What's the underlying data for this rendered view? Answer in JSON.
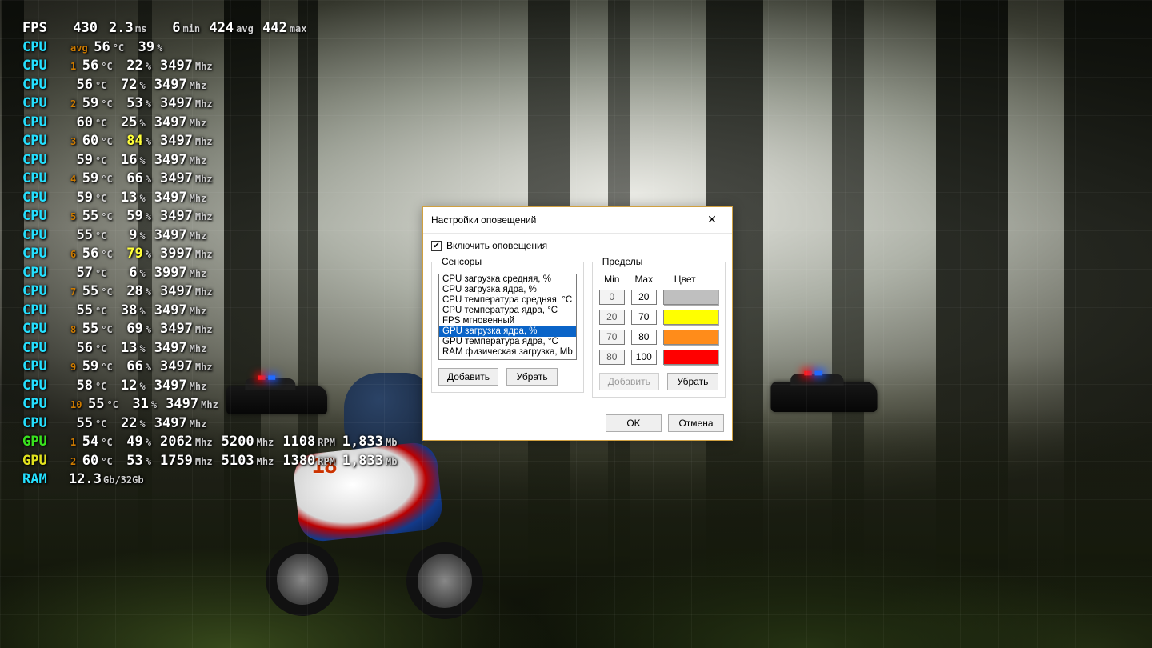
{
  "fps": {
    "label": "FPS",
    "value": "430",
    "ms": "2.3",
    "ms_unit": "ms",
    "min": "6",
    "min_unit": "min",
    "avg": "424",
    "avg_unit": "avg",
    "max": "442",
    "max_unit": "max"
  },
  "cpu_avg": {
    "label": "CPU",
    "idx": "avg",
    "temp": "56",
    "pct": "39"
  },
  "units": {
    "deg": "°C",
    "pct": "%",
    "mhz": "Mhz",
    "rpm": "RPM",
    "mb": "Mb",
    "gb": "Gb/32Gb"
  },
  "cpus": [
    {
      "label": "CPU",
      "idx": "1",
      "temp": "56",
      "pct": "22",
      "pct_hi": false,
      "mhz": "3497"
    },
    {
      "label": "CPU",
      "idx": "",
      "temp": "56",
      "pct": "72",
      "pct_hi": false,
      "mhz": "3497"
    },
    {
      "label": "CPU",
      "idx": "2",
      "temp": "59",
      "pct": "53",
      "pct_hi": false,
      "mhz": "3497"
    },
    {
      "label": "CPU",
      "idx": "",
      "temp": "60",
      "pct": "25",
      "pct_hi": false,
      "mhz": "3497"
    },
    {
      "label": "CPU",
      "idx": "3",
      "temp": "60",
      "pct": "84",
      "pct_hi": true,
      "mhz": "3497"
    },
    {
      "label": "CPU",
      "idx": "",
      "temp": "59",
      "pct": "16",
      "pct_hi": false,
      "mhz": "3497"
    },
    {
      "label": "CPU",
      "idx": "4",
      "temp": "59",
      "pct": "66",
      "pct_hi": false,
      "mhz": "3497"
    },
    {
      "label": "CPU",
      "idx": "",
      "temp": "59",
      "pct": "13",
      "pct_hi": false,
      "mhz": "3497"
    },
    {
      "label": "CPU",
      "idx": "5",
      "temp": "55",
      "pct": "59",
      "pct_hi": false,
      "mhz": "3497"
    },
    {
      "label": "CPU",
      "idx": "",
      "temp": "55",
      "pct": "9",
      "pct_hi": false,
      "mhz": "3497"
    },
    {
      "label": "CPU",
      "idx": "6",
      "temp": "56",
      "pct": "79",
      "pct_hi": true,
      "mhz": "3997"
    },
    {
      "label": "CPU",
      "idx": "",
      "temp": "57",
      "pct": "6",
      "pct_hi": false,
      "mhz": "3997"
    },
    {
      "label": "CPU",
      "idx": "7",
      "temp": "55",
      "pct": "28",
      "pct_hi": false,
      "mhz": "3497"
    },
    {
      "label": "CPU",
      "idx": "",
      "temp": "55",
      "pct": "38",
      "pct_hi": false,
      "mhz": "3497"
    },
    {
      "label": "CPU",
      "idx": "8",
      "temp": "55",
      "pct": "69",
      "pct_hi": false,
      "mhz": "3497"
    },
    {
      "label": "CPU",
      "idx": "",
      "temp": "56",
      "pct": "13",
      "pct_hi": false,
      "mhz": "3497"
    },
    {
      "label": "CPU",
      "idx": "9",
      "temp": "59",
      "pct": "66",
      "pct_hi": false,
      "mhz": "3497"
    },
    {
      "label": "CPU",
      "idx": "",
      "temp": "58",
      "pct": "12",
      "pct_hi": false,
      "mhz": "3497"
    },
    {
      "label": "CPU",
      "idx": "10",
      "temp": "55",
      "pct": "31",
      "pct_hi": false,
      "mhz": "3497"
    },
    {
      "label": "CPU",
      "idx": "",
      "temp": "55",
      "pct": "22",
      "pct_hi": false,
      "mhz": "3497"
    }
  ],
  "gpus": [
    {
      "label": "GPU",
      "idx": "1",
      "temp": "54",
      "pct": "49",
      "clk": "2062",
      "mem": "5200",
      "fan": "1108",
      "vram": "1,833"
    },
    {
      "label": "GPU",
      "idx": "2",
      "temp": "60",
      "pct": "53",
      "clk": "1759",
      "mem": "5103",
      "fan": "1380",
      "vram": "1,833"
    }
  ],
  "ram": {
    "label": "RAM",
    "value": "12.3"
  },
  "dialog": {
    "title": "Настройки оповещений",
    "enable_label": "Включить оповещения",
    "enable_checked": true,
    "sensors_legend": "Сенсоры",
    "sensor_items": [
      "CPU загрузка средняя, %",
      "CPU загрузка ядра, %",
      "CPU температура средняя, °C",
      "CPU температура ядра, °C",
      "FPS мгновенный",
      "GPU загрузка ядра, %",
      "GPU температура ядра, °C",
      "RAM физическая загрузка, Mb"
    ],
    "sensor_selected_index": 5,
    "add": "Добавить",
    "remove": "Убрать",
    "limits_legend": "Пределы",
    "min_h": "Min",
    "max_h": "Max",
    "color_h": "Цвет",
    "rows": [
      {
        "min": "0",
        "max": "20",
        "color": "#bfbfbf"
      },
      {
        "min": "20",
        "max": "70",
        "color": "#ffff00"
      },
      {
        "min": "70",
        "max": "80",
        "color": "#ff8c1a"
      },
      {
        "min": "80",
        "max": "100",
        "color": "#ff0000"
      }
    ],
    "add2": "Добавить",
    "remove2": "Убрать",
    "ok": "OK",
    "cancel": "Отмена"
  },
  "bike_number": "18"
}
